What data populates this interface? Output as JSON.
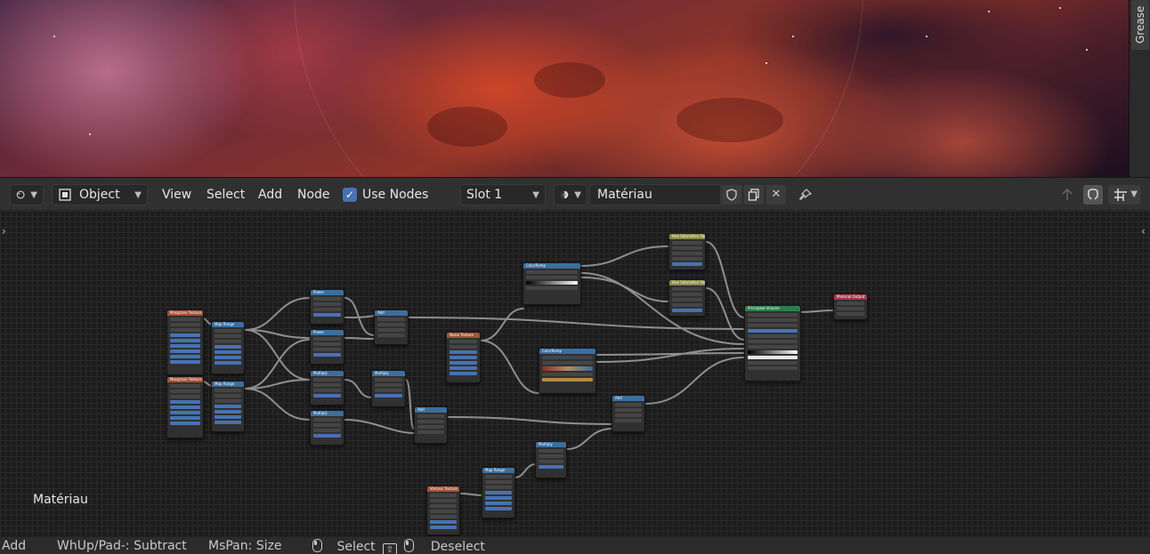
{
  "sidebar_tab": {
    "label": "Grease"
  },
  "header": {
    "editor_type_icon": "node-editor-icon",
    "object_mode": {
      "icon": "object-icon",
      "value": "Object"
    },
    "menus": [
      "View",
      "Select",
      "Add",
      "Node"
    ],
    "use_nodes": {
      "label": "Use Nodes",
      "checked": true
    },
    "slot": {
      "value": "Slot 1"
    },
    "material_browse_icon": "material-sphere-icon",
    "material_name": "Matériau",
    "fake_user_icon": "shield-icon",
    "duplicate_icon": "duplicate-icon",
    "unlink_icon": "close-icon",
    "pin_icon": "pin-icon",
    "right_tools": [
      "parent-node-tree-icon",
      "snap-icon",
      "overlay-icon"
    ]
  },
  "editor": {
    "material_label": "Matériau",
    "nodes": [
      {
        "id": "musgrave-1",
        "title": "Musgrave Texture",
        "color": "orange"
      },
      {
        "id": "musgrave-2",
        "title": "Musgrave Texture",
        "color": "orange"
      },
      {
        "id": "map-range-1",
        "title": "Map Range",
        "color": "blue"
      },
      {
        "id": "map-range-2",
        "title": "Map Range",
        "color": "blue"
      },
      {
        "id": "power-1",
        "title": "Power",
        "color": "blue"
      },
      {
        "id": "power-2",
        "title": "Power",
        "color": "blue"
      },
      {
        "id": "multiply-1",
        "title": "Multiply",
        "color": "blue"
      },
      {
        "id": "multiply-2",
        "title": "Multiply",
        "color": "blue"
      },
      {
        "id": "add-1",
        "title": "Add",
        "color": "blue"
      },
      {
        "id": "multiply-3",
        "title": "Multiply",
        "color": "blue"
      },
      {
        "id": "add-2",
        "title": "Add",
        "color": "blue"
      },
      {
        "id": "noise-texture",
        "title": "Noise Texture",
        "color": "orange"
      },
      {
        "id": "colorramp-1",
        "title": "ColorRamp",
        "color": "blue"
      },
      {
        "id": "colorramp-2",
        "title": "ColorRamp",
        "color": "blue"
      },
      {
        "id": "hsv-1",
        "title": "Hue Saturation Value",
        "color": "yellow"
      },
      {
        "id": "hsv-2",
        "title": "Hue Saturation Value",
        "color": "yellow"
      },
      {
        "id": "principled-volume",
        "title": "Principled Volume",
        "color": "green"
      },
      {
        "id": "material-output",
        "title": "Material Output",
        "color": "red"
      },
      {
        "id": "add-3",
        "title": "Add",
        "color": "blue"
      },
      {
        "id": "multiply-4",
        "title": "Multiply",
        "color": "blue"
      },
      {
        "id": "map-range-3",
        "title": "Map Range",
        "color": "blue"
      },
      {
        "id": "voronoi-texture",
        "title": "Voronoi Texture",
        "color": "orange"
      }
    ]
  },
  "statusbar": {
    "add": "Add",
    "wheel": "WhUp/Pad-: Subtract",
    "pan": "MsPan: Size",
    "select": "Select",
    "deselect": "Deselect"
  },
  "colors": {
    "header_bg": "#303030",
    "editor_bg": "#1d1d1d",
    "accent_blue": "#4772b3",
    "node_body": "#303030"
  }
}
